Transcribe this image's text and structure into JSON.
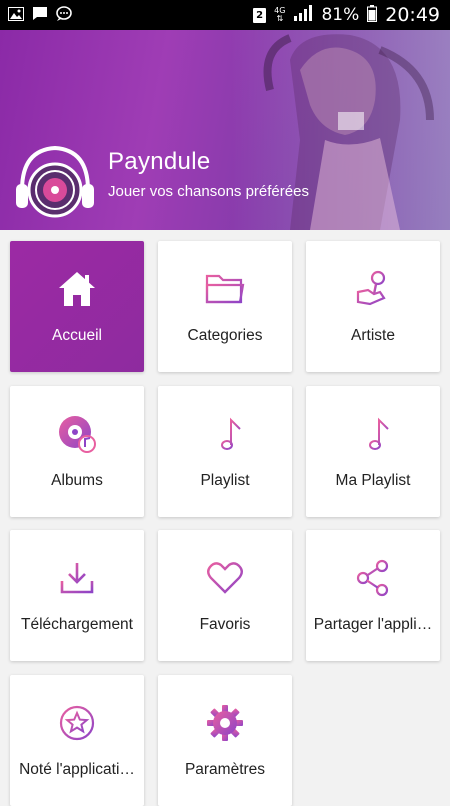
{
  "status_bar": {
    "sim_slot": "2",
    "network": "4G",
    "battery": "81%",
    "time": "20:49"
  },
  "header": {
    "app_name": "Payndule",
    "tagline": "Jouer vos chansons préférées"
  },
  "menu": [
    {
      "label": "Accueil",
      "icon": "home-icon",
      "active": true
    },
    {
      "label": "Categories",
      "icon": "folder-icon",
      "active": false
    },
    {
      "label": "Artiste",
      "icon": "microphone-icon",
      "active": false
    },
    {
      "label": "Albums",
      "icon": "album-disc-icon",
      "active": false
    },
    {
      "label": "Playlist",
      "icon": "playlist-icon",
      "active": false
    },
    {
      "label": "Ma Playlist",
      "icon": "playlist-icon",
      "active": false
    },
    {
      "label": "Téléchargement",
      "icon": "download-icon",
      "active": false
    },
    {
      "label": "Favoris",
      "icon": "heart-icon",
      "active": false
    },
    {
      "label": "Partager l'appli…",
      "icon": "share-icon",
      "active": false
    },
    {
      "label": "Noté l'applicati…",
      "icon": "star-icon",
      "active": false
    },
    {
      "label": "Paramètres",
      "icon": "gear-icon",
      "active": false
    }
  ],
  "colors": {
    "accent": "#9c2aa4",
    "icon_gradient_start": "#e85fa0",
    "icon_gradient_end": "#8e44c7"
  }
}
